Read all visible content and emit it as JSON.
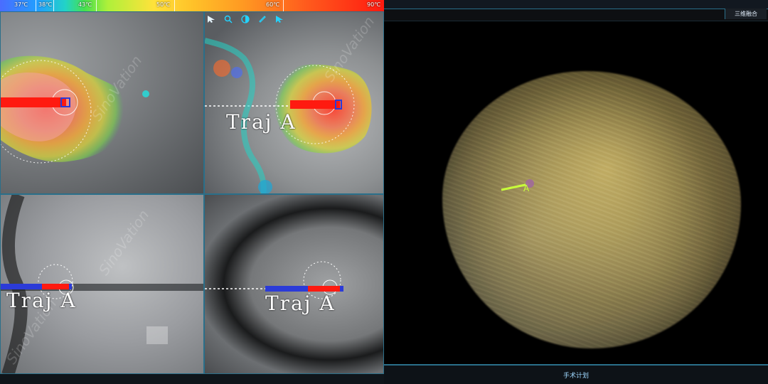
{
  "colorbar": {
    "labels": [
      "37℃",
      "38℃",
      "43℃",
      "50℃",
      "60℃",
      "90℃"
    ]
  },
  "views": {
    "watermark": "SinoVation",
    "trajectory_label": "Traj A"
  },
  "toolbar": {
    "tools": [
      {
        "name": "pointer",
        "icon": "cursor-arrow-icon"
      },
      {
        "name": "zoom",
        "icon": "magnifier-icon"
      },
      {
        "name": "window-level",
        "icon": "contrast-icon"
      },
      {
        "name": "measure",
        "icon": "ruler-icon"
      },
      {
        "name": "select-add",
        "icon": "cursor-plus-icon"
      }
    ]
  },
  "right_panel": {
    "fusion_button": "三维融合",
    "footer_title": "手术计划",
    "trajectory_label_3d": "A"
  },
  "colors": {
    "accent": "#2a6f8a",
    "needle_red": "#ff1a10",
    "needle_blue": "#2b3bd8",
    "traj_3d_label": "#c8ff3a"
  }
}
